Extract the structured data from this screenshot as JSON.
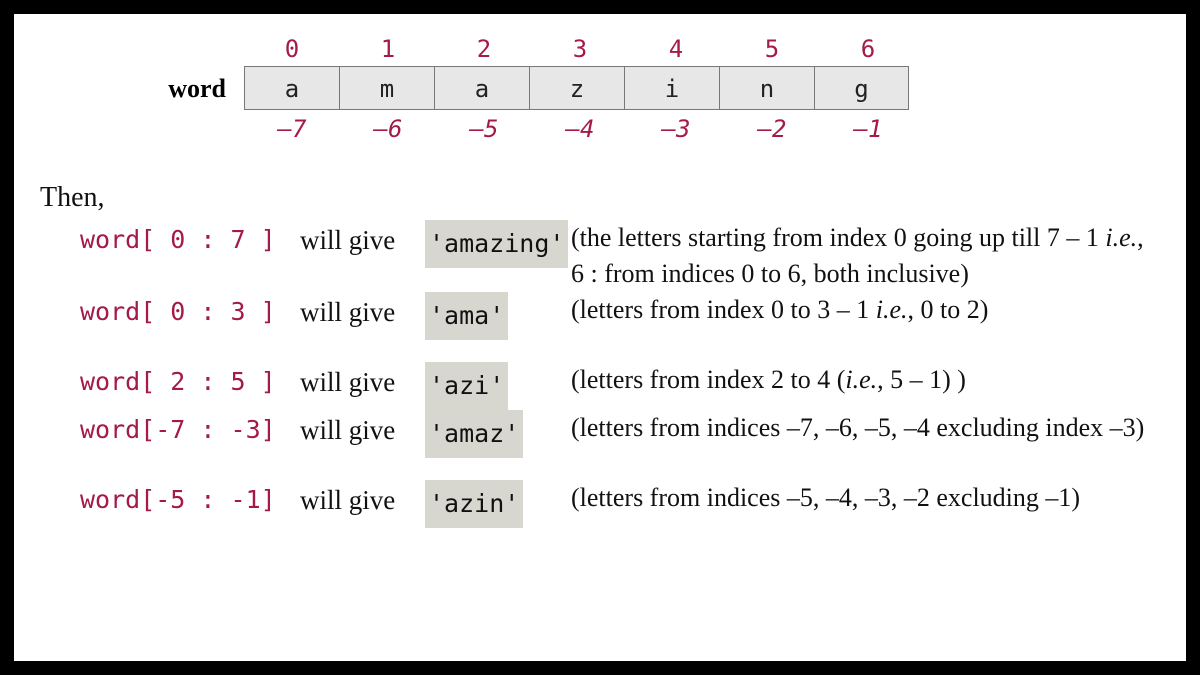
{
  "word_label": "word",
  "pos_idx": [
    "0",
    "1",
    "2",
    "3",
    "4",
    "5",
    "6"
  ],
  "letters": [
    "a",
    "m",
    "a",
    "z",
    "i",
    "n",
    "g"
  ],
  "neg_idx": [
    "–7",
    "–6",
    "–5",
    "–4",
    "–3",
    "–2",
    "–1"
  ],
  "then_text": "Then,",
  "will_give": "will give",
  "ex1": {
    "code": "word[ 0 : 7 ]",
    "result": "'amazing'",
    "expl": "(the letters starting from index 0 going up till 7 – 1 <i>i.e.</i>, 6 : from indices 0 to 6, both inclusive)"
  },
  "ex2": {
    "code": "word[ 0 : 3 ]",
    "result": "'ama'",
    "expl": "(letters from index 0 to 3 – 1 <i>i.e.</i>, 0 to 2)"
  },
  "ex3": {
    "code": "word[ 2 : 5 ]",
    "result": "'azi'",
    "expl": "(letters from index 2 to 4 (<i>i.e.</i>, 5 – 1) )"
  },
  "ex4": {
    "code": "word[-7 : -3]",
    "result": "'amaz'",
    "expl": "(letters from indices –7, –6, –5, –4  excluding index –3)"
  },
  "ex5": {
    "code": "word[-5 : -1]",
    "result": "'azin'",
    "expl": "(letters from indices –5, –4, –3, –2 excluding –1)"
  }
}
